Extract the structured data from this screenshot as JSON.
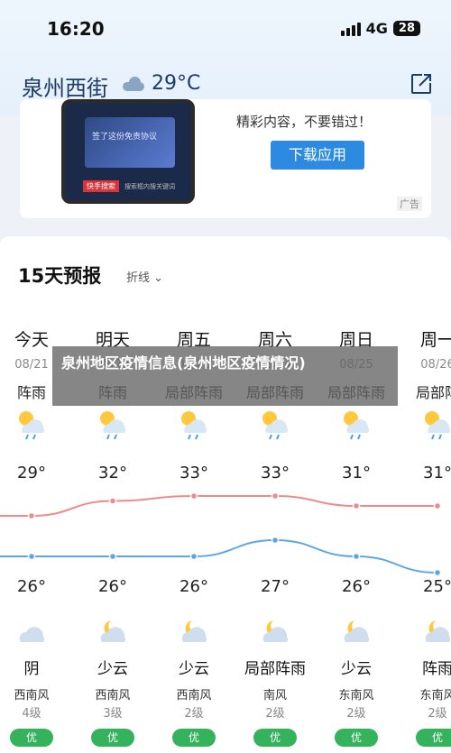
{
  "status": {
    "time": "16:20",
    "network": "4G",
    "battery": "28"
  },
  "header": {
    "city": "泉州西街",
    "temperature": "29°C"
  },
  "ad": {
    "text": "精彩内容，不要错过！",
    "button": "下载应用",
    "tag": "广告",
    "phone_caption": "签了这份免责协议",
    "phone_tag": "快手搜索",
    "phone_tag2": "搜索框内搜关键词"
  },
  "forecast": {
    "title": "15天预报",
    "toggle": "折线",
    "days": [
      {
        "name": "今天",
        "date": "08/21",
        "day_cond": "阵雨",
        "high": "29°",
        "low": "26°",
        "night_cond": "阴",
        "wind_dir": "西南风",
        "wind_level": "4级",
        "aqi": "优"
      },
      {
        "name": "明天",
        "date": "08/22",
        "day_cond": "阵雨",
        "high": "32°",
        "low": "26°",
        "night_cond": "少云",
        "wind_dir": "西南风",
        "wind_level": "3级",
        "aqi": "优"
      },
      {
        "name": "周五",
        "date": "08/23",
        "day_cond": "局部阵雨",
        "high": "33°",
        "low": "26°",
        "night_cond": "少云",
        "wind_dir": "西南风",
        "wind_level": "2级",
        "aqi": "优"
      },
      {
        "name": "周六",
        "date": "08/24",
        "day_cond": "局部阵雨",
        "high": "33°",
        "low": "27°",
        "night_cond": "局部阵雨",
        "wind_dir": "南风",
        "wind_level": "2级",
        "aqi": "优"
      },
      {
        "name": "周日",
        "date": "08/25",
        "day_cond": "局部阵雨",
        "high": "31°",
        "low": "26°",
        "night_cond": "少云",
        "wind_dir": "东南风",
        "wind_level": "2级",
        "aqi": "优"
      },
      {
        "name": "周一",
        "date": "08/26",
        "day_cond": "局部阵",
        "high": "31°",
        "low": "25°",
        "night_cond": "阵雨",
        "wind_dir": "东南风",
        "wind_level": "2级",
        "aqi": "优"
      }
    ]
  },
  "news_banner": "泉州地区疫情信息(泉州地区疫情情况)",
  "colors": {
    "high_line": "#f08a8a",
    "low_line": "#5aa6e8",
    "aqi_good": "#34b35c",
    "header_text": "#1d3b6a"
  }
}
